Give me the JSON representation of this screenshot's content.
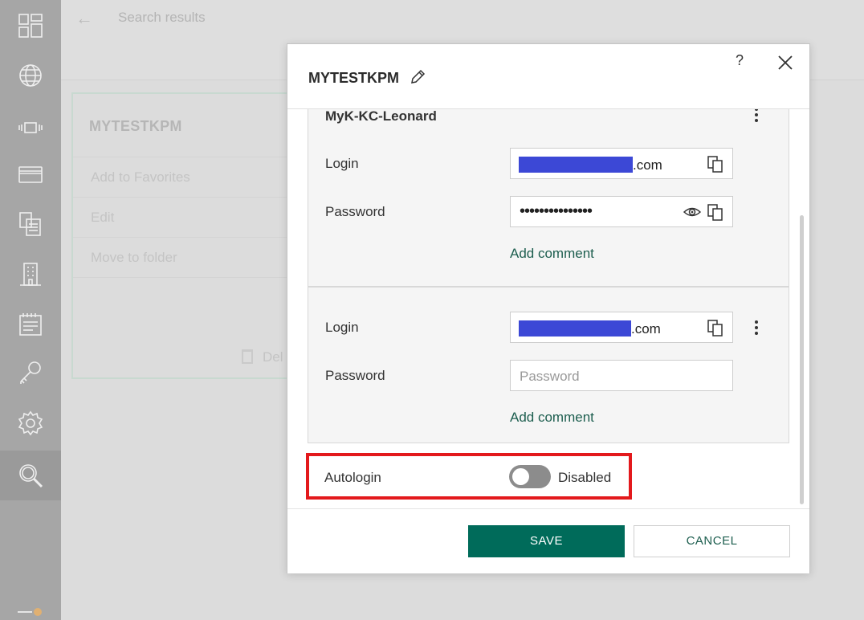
{
  "background": {
    "breadcrumb": "Search results",
    "card_title": "MYTESTKPM",
    "card_menu": [
      "Add to Favorites",
      "Edit",
      "Move to folder"
    ],
    "card_delete": "Del"
  },
  "sidebar": {
    "items": [
      {
        "icon": "dashboard-icon"
      },
      {
        "icon": "globe-icon"
      },
      {
        "icon": "applications-icon"
      },
      {
        "icon": "bank-card-icon"
      },
      {
        "icon": "documents-icon"
      },
      {
        "icon": "building-icon"
      },
      {
        "icon": "notes-icon"
      },
      {
        "icon": "key-icon"
      },
      {
        "icon": "gear-icon"
      },
      {
        "icon": "search-icon",
        "active": true
      }
    ]
  },
  "dialog": {
    "title": "MYTESTKPM",
    "help": "?",
    "accounts": [
      {
        "name": "MyK-KC-Leonard",
        "login_label": "Login",
        "login_suffix": ".com",
        "password_label": "Password",
        "password_masked": "•••••••••••••••",
        "add_comment": "Add comment"
      },
      {
        "name": "",
        "login_label": "Login",
        "login_suffix": ".com",
        "password_label": "Password",
        "password_placeholder": "Password",
        "add_comment": "Add comment"
      }
    ],
    "autologin": {
      "label": "Autologin",
      "status": "Disabled",
      "enabled": false
    },
    "save_label": "SAVE",
    "cancel_label": "CANCEL"
  },
  "colors": {
    "accent": "#006b5a",
    "link": "#1d5e4f",
    "highlight_border": "#e3191c",
    "redaction": "#3c48d6",
    "sidebar": "#a6a6a6"
  }
}
